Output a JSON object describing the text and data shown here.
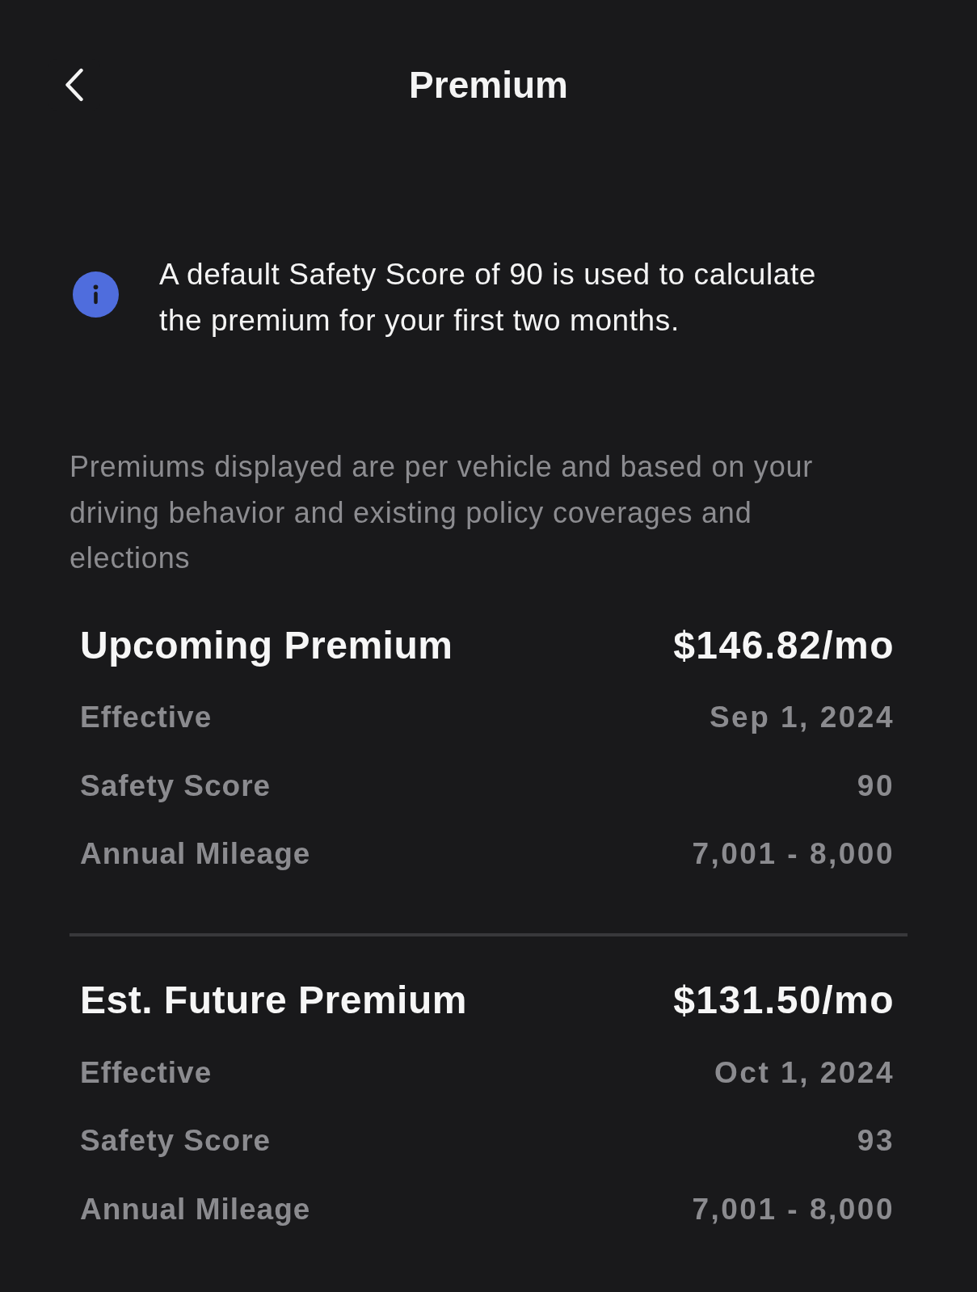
{
  "header": {
    "title": "Premium"
  },
  "info_note": {
    "text": "A default Safety Score of 90 is used to calculate the premium for your first two months."
  },
  "disclaimer": "Premiums displayed are per vehicle and based on your driving behavior and existing policy coverages and elections",
  "sections": [
    {
      "title": "Upcoming Premium",
      "amount": "$146.82/mo",
      "rows": [
        {
          "label": "Effective",
          "value": "Sep 1, 2024"
        },
        {
          "label": "Safety Score",
          "value": "90"
        },
        {
          "label": "Annual Mileage",
          "value": "7,001 - 8,000"
        }
      ]
    },
    {
      "title": "Est. Future Premium",
      "amount": "$131.50/mo",
      "rows": [
        {
          "label": "Effective",
          "value": "Oct 1, 2024"
        },
        {
          "label": "Safety Score",
          "value": "93"
        },
        {
          "label": "Annual Mileage",
          "value": "7,001 - 8,000"
        }
      ]
    }
  ]
}
